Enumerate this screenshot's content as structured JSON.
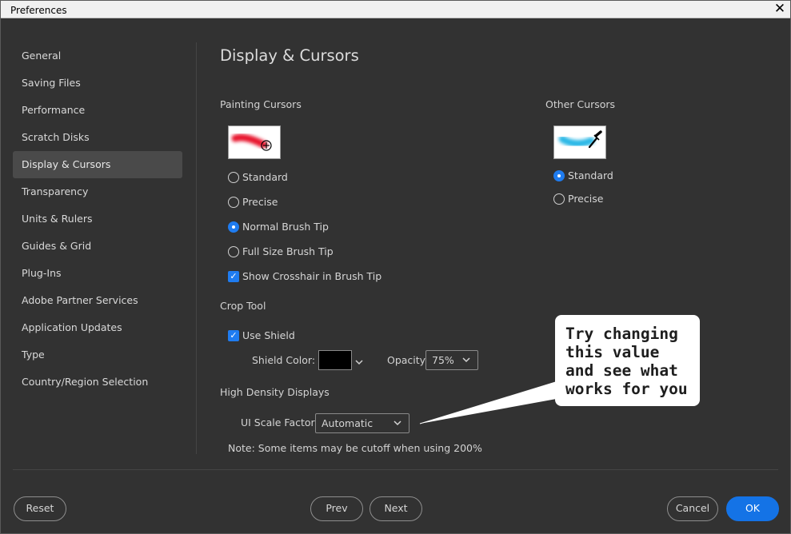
{
  "window": {
    "title": "Preferences",
    "close_glyph": "✕"
  },
  "sidebar": {
    "items": [
      {
        "label": "General"
      },
      {
        "label": "Saving Files"
      },
      {
        "label": "Performance"
      },
      {
        "label": "Scratch Disks"
      },
      {
        "label": "Display & Cursors",
        "active": true
      },
      {
        "label": "Transparency"
      },
      {
        "label": "Units & Rulers"
      },
      {
        "label": "Guides & Grid"
      },
      {
        "label": "Plug-Ins"
      },
      {
        "label": "Adobe Partner Services"
      },
      {
        "label": "Application Updates"
      },
      {
        "label": "Type"
      },
      {
        "label": "Country/Region Selection"
      }
    ]
  },
  "main": {
    "heading": "Display & Cursors",
    "painting_cursors": {
      "label": "Painting Cursors",
      "options": [
        {
          "label": "Standard",
          "selected": false
        },
        {
          "label": "Precise",
          "selected": false
        },
        {
          "label": "Normal Brush Tip",
          "selected": true
        },
        {
          "label": "Full Size Brush Tip",
          "selected": false
        }
      ],
      "crosshair": {
        "label": "Show Crosshair in Brush Tip",
        "checked": true
      }
    },
    "other_cursors": {
      "label": "Other Cursors",
      "options": [
        {
          "label": "Standard",
          "selected": true
        },
        {
          "label": "Precise",
          "selected": false
        }
      ]
    },
    "crop_tool": {
      "label": "Crop Tool",
      "use_shield": {
        "label": "Use Shield",
        "checked": true
      },
      "shield_color_label": "Shield Color:",
      "shield_color": "#000000",
      "opacity_label": "Opacity:",
      "opacity_value": "75%"
    },
    "high_density": {
      "label": "High Density Displays",
      "ui_scale_label": "UI Scale Factor:",
      "ui_scale_value": "Automatic",
      "note": "Note: Some items may be cutoff when using 200%"
    }
  },
  "callout": {
    "lines": [
      "Try changing",
      "this value",
      "and see what",
      "works for you"
    ]
  },
  "footer": {
    "reset": "Reset",
    "prev": "Prev",
    "next": "Next",
    "cancel": "Cancel",
    "ok": "OK"
  },
  "colors": {
    "accent": "#1473e6",
    "background": "#323232",
    "painting_stroke": "#e8152e",
    "other_stroke": "#2ab8e6"
  }
}
